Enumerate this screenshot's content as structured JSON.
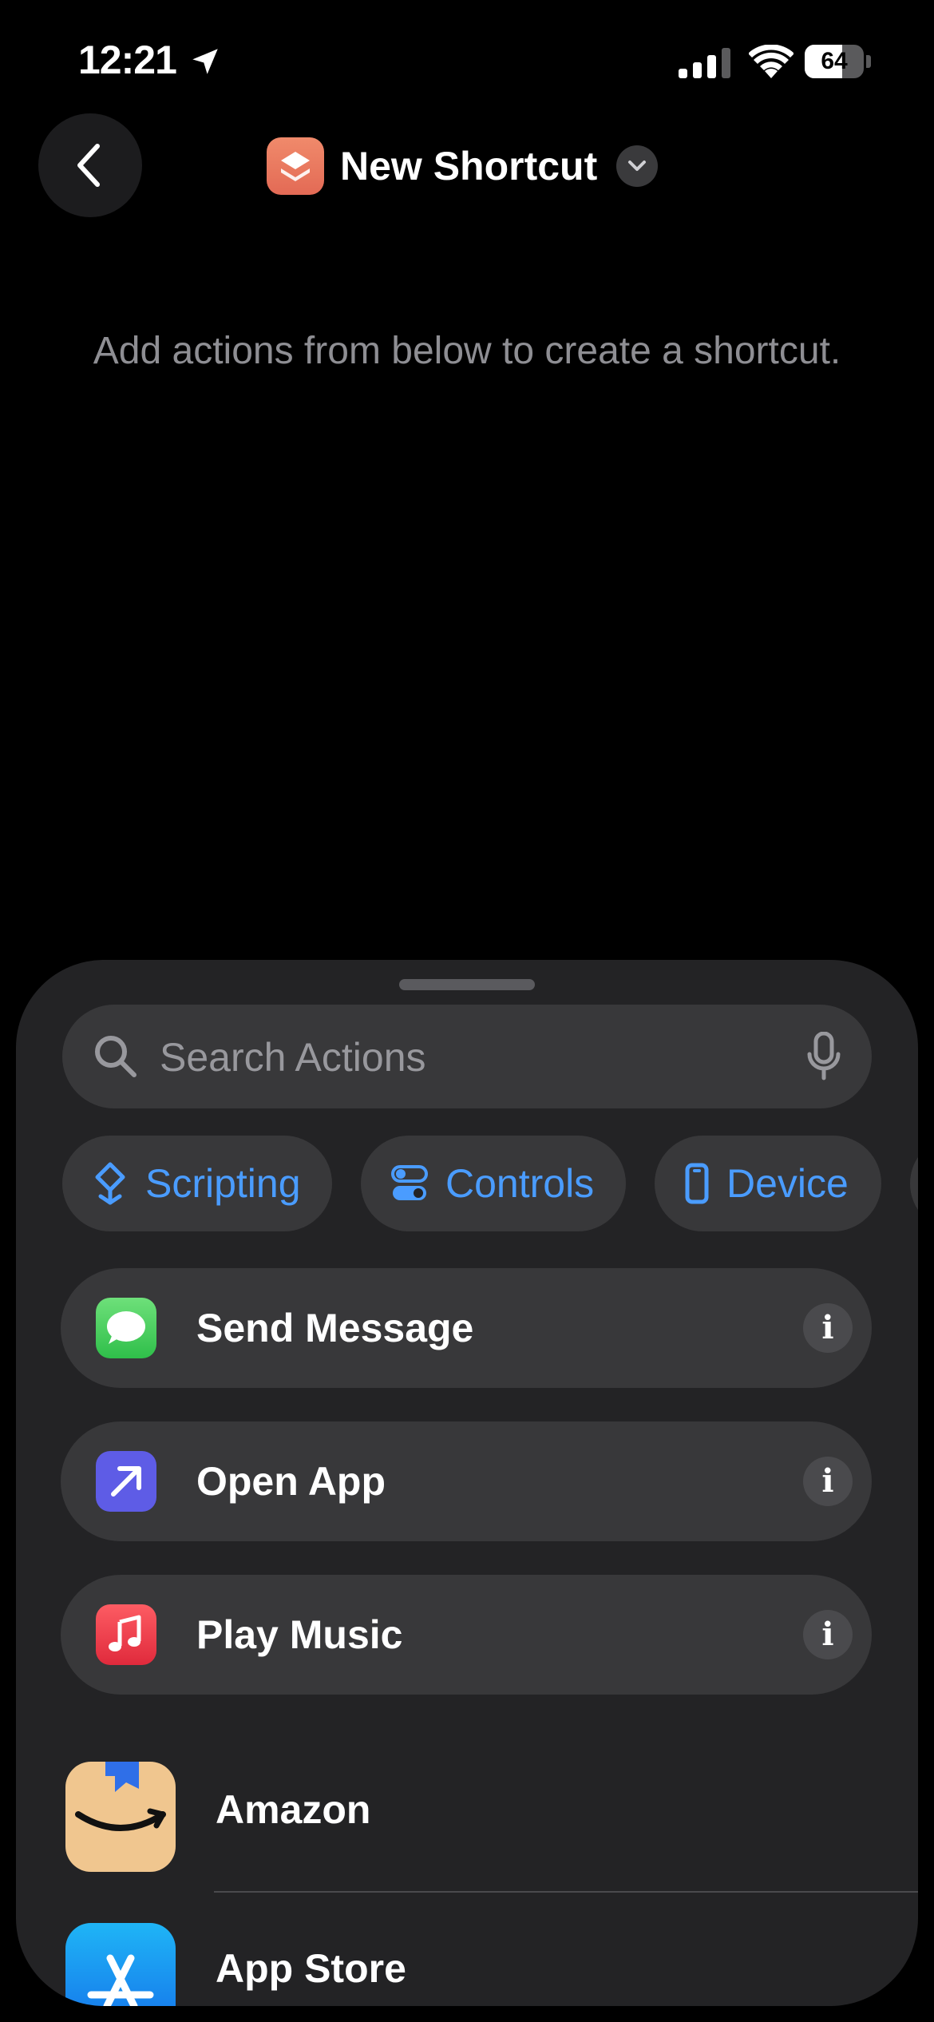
{
  "status": {
    "time": "12:21",
    "battery": "64",
    "battery_level": 0.64
  },
  "header": {
    "title": "New Shortcut"
  },
  "empty_hint": "Add actions from below to create a shortcut.",
  "search": {
    "placeholder": "Search Actions"
  },
  "categories": [
    {
      "label": "Scripting",
      "icon": "scripting-icon"
    },
    {
      "label": "Controls",
      "icon": "controls-toggle-icon"
    },
    {
      "label": "Device",
      "icon": "phone-icon"
    }
  ],
  "actions": [
    {
      "label": "Send Message",
      "icon": "messages-icon",
      "color": "#34c759"
    },
    {
      "label": "Open App",
      "icon": "open-app-arrow-icon",
      "color": "#5e5ce6"
    },
    {
      "label": "Play Music",
      "icon": "music-note-icon",
      "color": "#fc3c44"
    }
  ],
  "apps": [
    {
      "label": "Amazon",
      "icon": "amazon-icon"
    },
    {
      "label": "App Store",
      "icon": "app-store-icon"
    }
  ],
  "info_glyph": "i",
  "accent": "#4a9cff"
}
